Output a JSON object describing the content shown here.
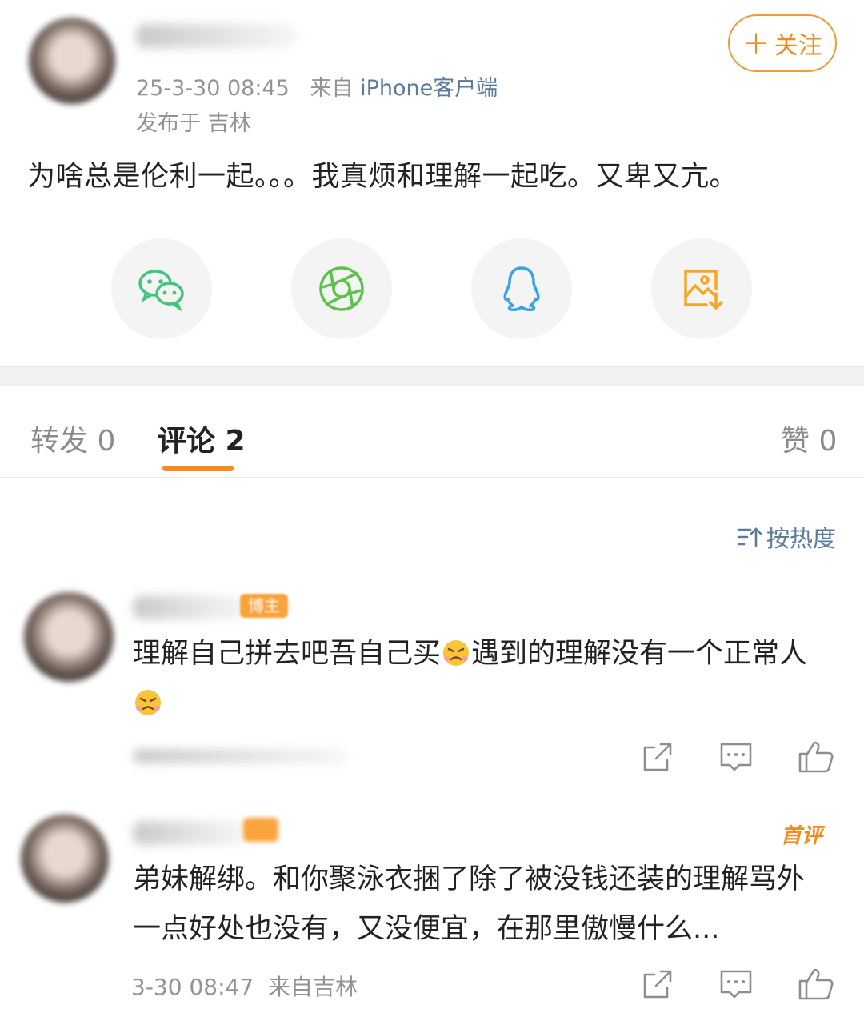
{
  "post": {
    "time": "25-3-30 08:45",
    "source_prefix": "来自",
    "source": "iPhone客户端",
    "location": "发布于 吉林",
    "follow_label": "关注",
    "text": "为啥总是伦利一起。。。我真烦和理解一起吃。又卑又亢。"
  },
  "share": {
    "items": [
      {
        "name": "wechat",
        "icon": "wechat-icon",
        "color": "#3fc67a"
      },
      {
        "name": "moments",
        "icon": "moments-icon",
        "color": "#5dc24b"
      },
      {
        "name": "qq",
        "icon": "qq-icon",
        "color": "#3aa3e6"
      },
      {
        "name": "save-image",
        "icon": "save-image-icon",
        "color": "#f5a623"
      }
    ]
  },
  "tabs": {
    "repost": "转发 0",
    "comments": "评论 2",
    "likes": "赞 0"
  },
  "sort_label": "按热度",
  "comments": [
    {
      "badge": "博主",
      "text_before": "理解自己拼去吧吾自己买",
      "text_middle": "遇到的理解没有一个正常人",
      "emoji": "angry-emoji"
    },
    {
      "first_badge": "首评",
      "text": "弟妹解绑。和你聚泳衣捆了除了被没钱还装的理解骂外一点好处也没有，又没便宜，在那里傲慢什么...",
      "time": "3-30 08:47",
      "source": "来自吉林"
    }
  ],
  "colors": {
    "accent": "#f28a1e",
    "link": "#5b7a9e"
  }
}
